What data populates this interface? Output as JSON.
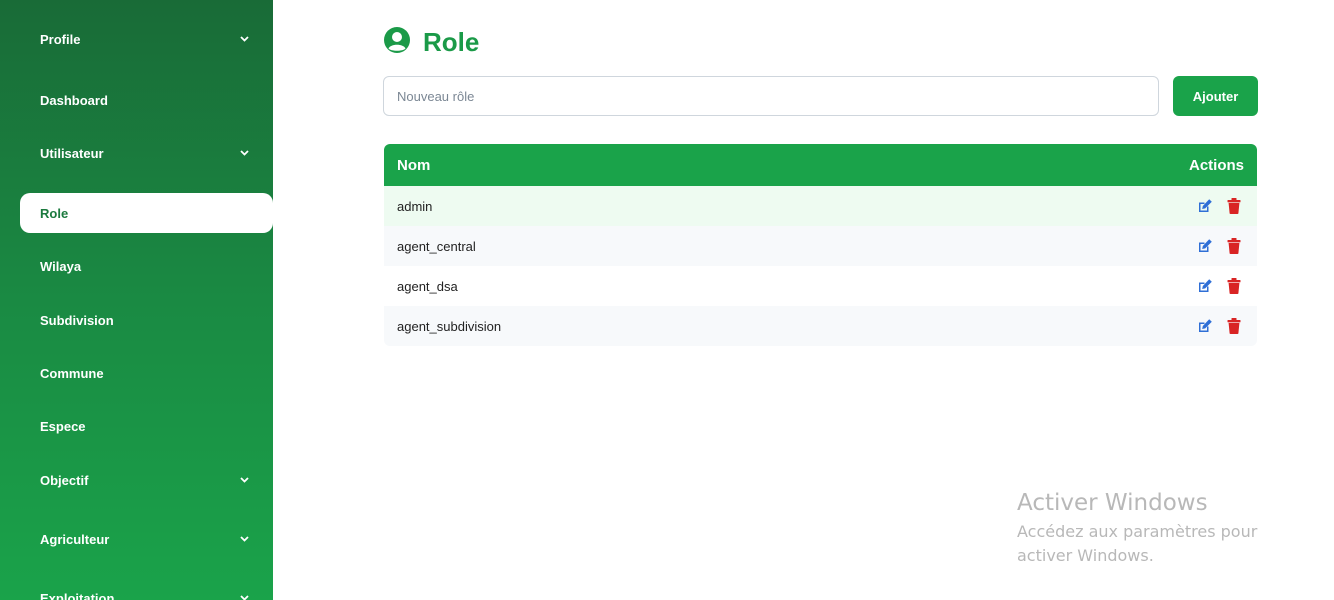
{
  "sidebar": {
    "items": [
      {
        "label": "Profile",
        "has_chevron": true
      },
      {
        "label": "Dashboard",
        "has_chevron": false
      },
      {
        "label": "Utilisateur",
        "has_chevron": true
      },
      {
        "label": "Role",
        "has_chevron": false,
        "active": true
      },
      {
        "label": "Wilaya",
        "has_chevron": false
      },
      {
        "label": "Subdivision",
        "has_chevron": false
      },
      {
        "label": "Commune",
        "has_chevron": false
      },
      {
        "label": "Espece",
        "has_chevron": false
      },
      {
        "label": "Objectif",
        "has_chevron": true
      },
      {
        "label": "Agriculteur",
        "has_chevron": true
      },
      {
        "label": "Exploitation",
        "has_chevron": true
      }
    ]
  },
  "main": {
    "title": "Role",
    "title_icon": "user-circle-icon",
    "new_role_placeholder": "Nouveau rôle",
    "new_role_value": "",
    "add_label": "Ajouter"
  },
  "table": {
    "headers": {
      "name": "Nom",
      "actions": "Actions"
    },
    "rows": [
      {
        "name": "admin"
      },
      {
        "name": "agent_central"
      },
      {
        "name": "agent_dsa"
      },
      {
        "name": "agent_subdivision"
      }
    ],
    "edit_icon": "edit-icon",
    "delete_icon": "trash-icon"
  },
  "watermark": {
    "title": "Activer Windows",
    "subtitle": "Accédez aux paramètres pour activer Windows."
  },
  "colors": {
    "brand_green": "#1aa34a",
    "sidebar_top": "#196b37",
    "title_green": "#1b9a48",
    "edit_blue": "#2f6fd6",
    "delete_red": "#d92424"
  }
}
